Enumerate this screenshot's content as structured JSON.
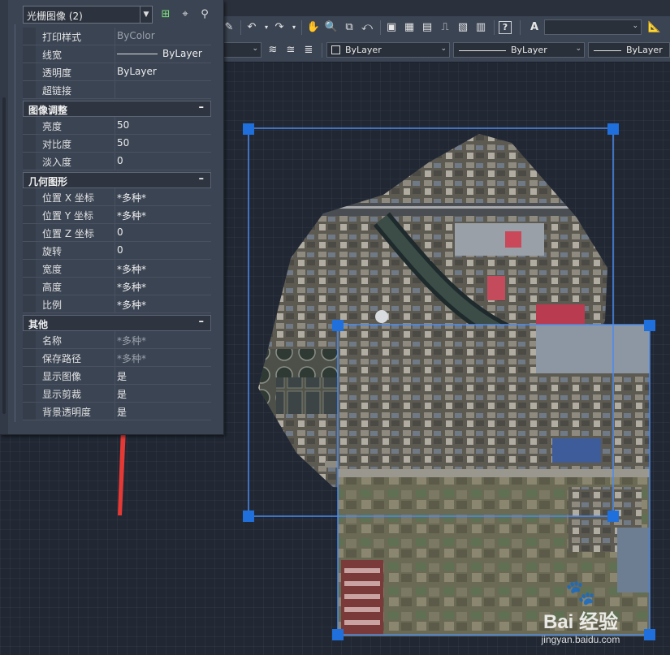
{
  "colors": {
    "canvas_bg": "#212834",
    "panel_bg": "#3b4453",
    "selection": "#1f6fdc",
    "arrow": "#e53935"
  },
  "palette": {
    "object_type": "光栅图像 (2)",
    "rows_top": [
      {
        "label": "打印样式",
        "value": "ByColor",
        "dim": true
      },
      {
        "label": "线宽",
        "value": "ByLayer",
        "line": true
      },
      {
        "label": "透明度",
        "value": "ByLayer"
      },
      {
        "label": "超链接",
        "value": ""
      }
    ],
    "sections": [
      {
        "title": "图像调整",
        "toggle": "–",
        "rows": [
          {
            "label": "亮度",
            "value": "50"
          },
          {
            "label": "对比度",
            "value": "50"
          },
          {
            "label": "淡入度",
            "value": "0"
          }
        ]
      },
      {
        "title": "几何图形",
        "toggle": "–",
        "rows": [
          {
            "label": "位置 X 坐标",
            "value": "*多种*"
          },
          {
            "label": "位置 Y 坐标",
            "value": "*多种*"
          },
          {
            "label": "位置 Z 坐标",
            "value": "0"
          },
          {
            "label": "旋转",
            "value": "0"
          },
          {
            "label": "宽度",
            "value": "*多种*"
          },
          {
            "label": "高度",
            "value": "*多种*"
          },
          {
            "label": "比例",
            "value": "*多种*"
          }
        ]
      },
      {
        "title": "其他",
        "toggle": "–",
        "rows": [
          {
            "label": "名称",
            "value": "*多种*",
            "dim": true
          },
          {
            "label": "保存路径",
            "value": "*多种*",
            "dim": true
          },
          {
            "label": "显示图像",
            "value": "是"
          },
          {
            "label": "显示剪裁",
            "value": "是"
          },
          {
            "label": "背景透明度",
            "value": "是"
          }
        ]
      }
    ]
  },
  "toolbar2": {
    "color_value": "ByLayer",
    "linetype_value": "ByLayer",
    "lineweight_value": "ByLayer"
  },
  "watermark": {
    "brand": "Bai  经验",
    "url": "jingyan.baidu.com"
  }
}
